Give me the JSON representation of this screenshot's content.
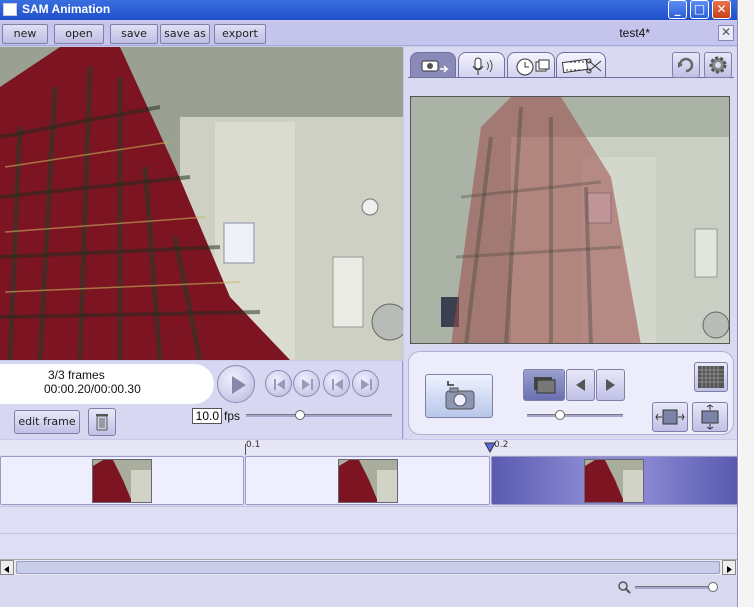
{
  "window": {
    "title": "SAM Animation",
    "controls": {
      "minimize": "_",
      "maximize": "□",
      "close": "✕"
    }
  },
  "menubar": {
    "buttons": [
      "new",
      "open",
      "save",
      "save as",
      "export"
    ],
    "project_title": "test4*",
    "close_label": "✕"
  },
  "left_panel": {
    "frame_count": "3/3 frames",
    "timecode": "00:00.20/00:00.30",
    "edit_frame_label": "edit frame",
    "fps_value": "10.0",
    "fps_label": "fps",
    "playback_level": 0.37
  },
  "right_panel": {
    "tabs": [
      {
        "icon": "camera-tab-icon",
        "active": true
      },
      {
        "icon": "microphone-tab-icon",
        "active": false
      },
      {
        "icon": "timer-tab-icon",
        "active": false
      },
      {
        "icon": "film-edit-tab-icon",
        "active": false
      }
    ],
    "onion_skin_level": 0.34
  },
  "timeline": {
    "ticks": [
      "0.1",
      "0.2"
    ],
    "frames": [
      {
        "selected": false
      },
      {
        "selected": false
      },
      {
        "selected": true
      }
    ]
  },
  "statusbar": {
    "zoom_level": 0.97
  },
  "colors": {
    "panel": "#c9c9ee",
    "accent": "#5a5ab0",
    "titlebar": "#1f4fc9"
  }
}
